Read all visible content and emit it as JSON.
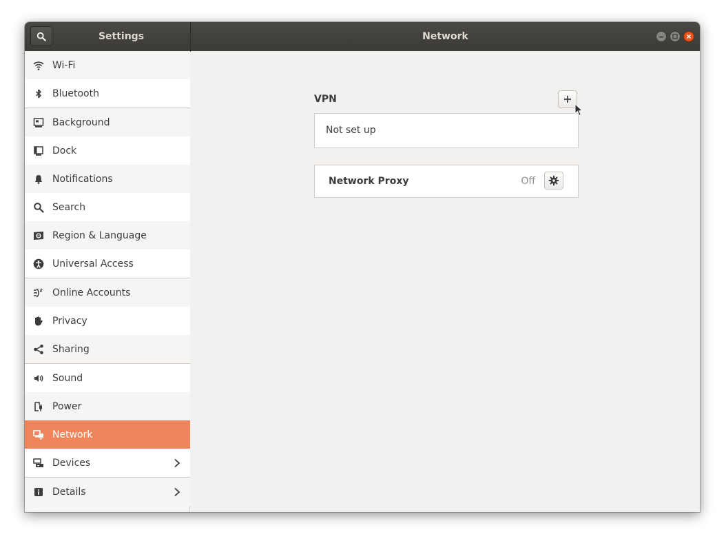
{
  "window": {
    "sidebar_title": "Settings",
    "page_title": "Network"
  },
  "sidebar": {
    "items": [
      {
        "label": "Wi-Fi",
        "icon": "wifi-icon"
      },
      {
        "label": "Bluetooth",
        "icon": "bluetooth-icon"
      },
      {
        "label": "Background",
        "icon": "background-icon"
      },
      {
        "label": "Dock",
        "icon": "dock-icon"
      },
      {
        "label": "Notifications",
        "icon": "bell-icon"
      },
      {
        "label": "Search",
        "icon": "search-icon"
      },
      {
        "label": "Region & Language",
        "icon": "region-icon"
      },
      {
        "label": "Universal Access",
        "icon": "accessibility-icon"
      },
      {
        "label": "Online Accounts",
        "icon": "online-accounts-icon"
      },
      {
        "label": "Privacy",
        "icon": "privacy-hand-icon"
      },
      {
        "label": "Sharing",
        "icon": "share-icon"
      },
      {
        "label": "Sound",
        "icon": "speaker-icon"
      },
      {
        "label": "Power",
        "icon": "power-icon"
      },
      {
        "label": "Network",
        "icon": "network-icon"
      },
      {
        "label": "Devices",
        "icon": "devices-icon"
      },
      {
        "label": "Details",
        "icon": "info-icon"
      }
    ],
    "active": "Network"
  },
  "main": {
    "vpn": {
      "heading": "VPN",
      "status": "Not set up"
    },
    "proxy": {
      "label": "Network Proxy",
      "state": "Off"
    }
  },
  "colors": {
    "accent": "#f0845a",
    "titlebar": "#3c3b37",
    "close": "#e95420"
  }
}
